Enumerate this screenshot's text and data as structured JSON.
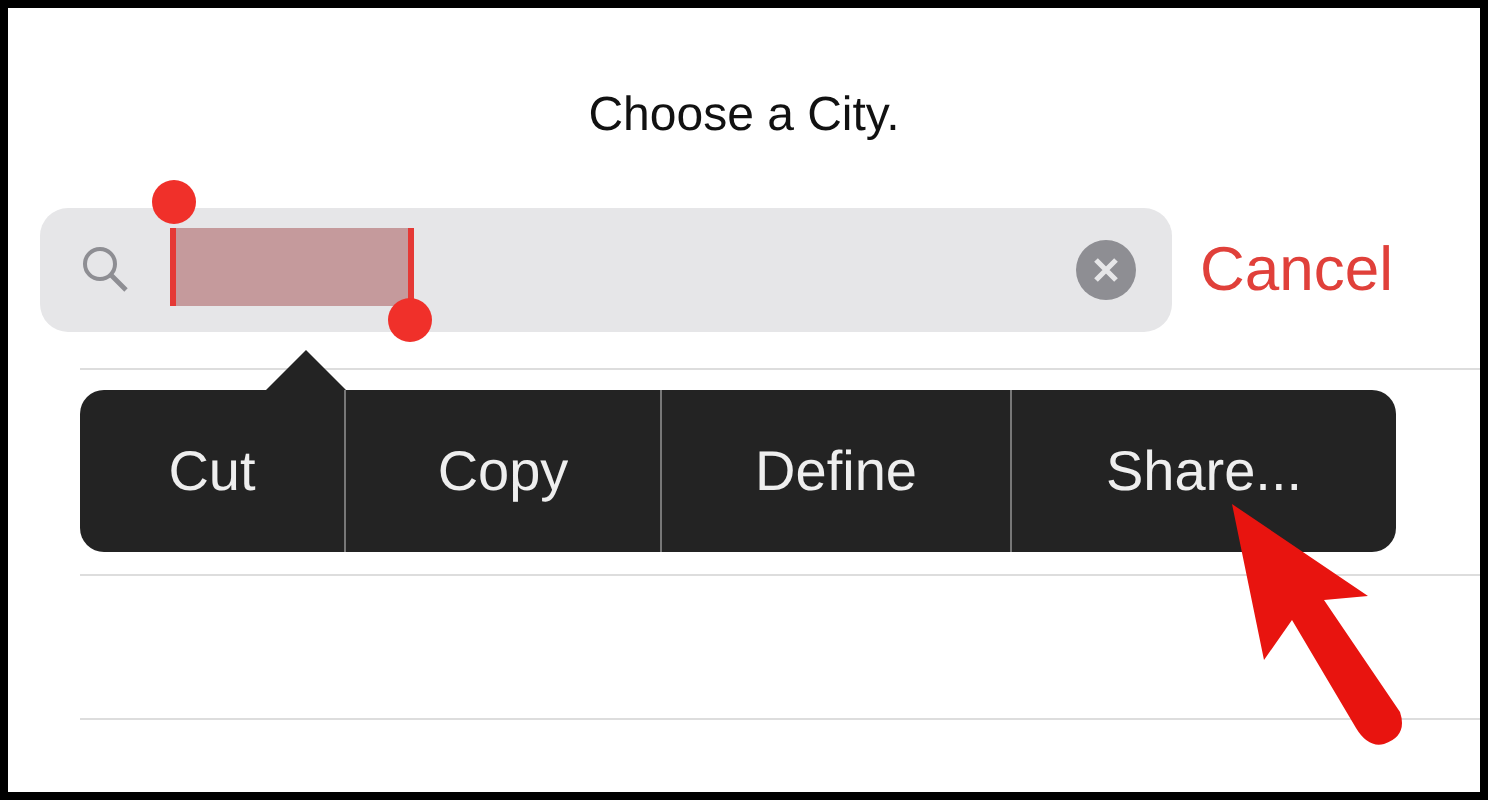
{
  "title": "Choose a City.",
  "search": {
    "selection": true
  },
  "cancel": "Cancel",
  "edit_menu": {
    "items": [
      {
        "label": "Cut"
      },
      {
        "label": "Copy"
      },
      {
        "label": "Define"
      },
      {
        "label": "Share..."
      }
    ]
  }
}
